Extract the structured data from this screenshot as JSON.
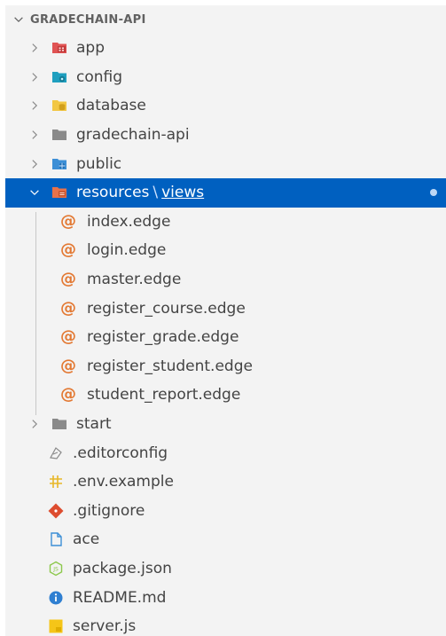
{
  "explorer": {
    "root_label": "GRADECHAIN-API",
    "folders_top": [
      {
        "label": "app",
        "icon": "folder-app-icon",
        "color": "#e05353"
      },
      {
        "label": "config",
        "icon": "folder-config-icon",
        "color": "#1f9fbf"
      },
      {
        "label": "database",
        "icon": "folder-database-icon",
        "color": "#f2c744"
      },
      {
        "label": "gradechain-api",
        "icon": "folder-icon",
        "color": "#8a8a8a"
      },
      {
        "label": "public",
        "icon": "folder-public-icon",
        "color": "#3d8fd6"
      }
    ],
    "selected_folder": {
      "label": "resources",
      "separator": "\\",
      "sub": "views",
      "icon": "folder-resources-icon",
      "color": "#e8724a"
    },
    "view_files": [
      "index.edge",
      "login.edge",
      "master.edge",
      "register_course.edge",
      "register_grade.edge",
      "register_student.edge",
      "student_report.edge"
    ],
    "view_file_icon": "@",
    "folders_bottom": [
      {
        "label": "start",
        "icon": "folder-icon",
        "color": "#8a8a8a"
      }
    ],
    "root_files": [
      {
        "label": ".editorconfig",
        "icon": "editorconfig-icon"
      },
      {
        "label": ".env.example",
        "icon": "env-icon"
      },
      {
        "label": ".gitignore",
        "icon": "git-icon"
      },
      {
        "label": "ace",
        "icon": "file-icon"
      },
      {
        "label": "package.json",
        "icon": "nodejs-icon"
      },
      {
        "label": "README.md",
        "icon": "info-icon"
      },
      {
        "label": "server.js",
        "icon": "javascript-icon"
      }
    ],
    "colors": {
      "selection": "#0060c0",
      "edge_icon": "#e37933",
      "background": "#f3f3f3"
    }
  }
}
